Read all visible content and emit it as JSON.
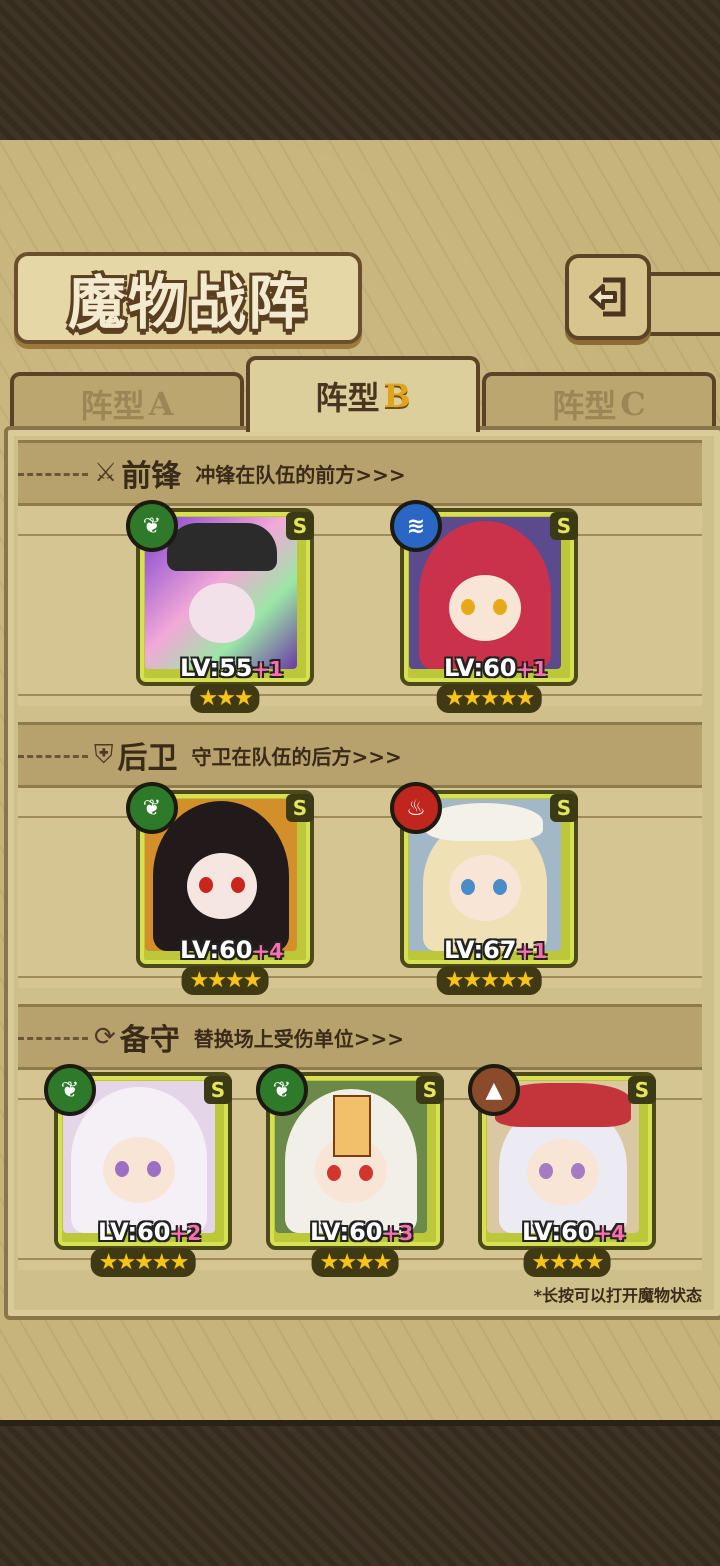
{
  "title": "魔物战阵",
  "back_icon": "back-arrow-icon",
  "tabs": [
    {
      "prefix": "阵型",
      "letter": "A",
      "active": false
    },
    {
      "prefix": "阵型",
      "letter": "B",
      "active": true
    },
    {
      "prefix": "阵型",
      "letter": "C",
      "active": false
    }
  ],
  "sections": {
    "front": {
      "icon": "sword-icon",
      "name": "前锋",
      "desc": "冲锋在队伍的前方>>>"
    },
    "back": {
      "icon": "shield-icon",
      "name": "后卫",
      "desc": "守卫在队伍的后方>>>"
    },
    "reserve": {
      "icon": "swap-icon",
      "name": "备守",
      "desc": "替换场上受伤单位>>>"
    }
  },
  "colors": {
    "nature": "#2f7a2a",
    "water": "#2a66c4",
    "fire": "#c0251e",
    "earth": "#8a4b2a",
    "star": "#f9c418"
  },
  "cards": {
    "front": [
      {
        "element": "nature",
        "rank": "S",
        "lv": "LV:55",
        "plus": "+1",
        "stars": "★★★"
      },
      {
        "element": "water",
        "rank": "S",
        "lv": "LV:60",
        "plus": "+1",
        "stars": "★★★★★"
      }
    ],
    "back": [
      {
        "element": "nature",
        "rank": "S",
        "lv": "LV:60",
        "plus": "+4",
        "stars": "★★★★"
      },
      {
        "element": "fire",
        "rank": "S",
        "lv": "LV:67",
        "plus": "+1",
        "stars": "★★★★★"
      }
    ],
    "reserve": [
      {
        "element": "nature",
        "rank": "S",
        "lv": "LV:60",
        "plus": "+2",
        "stars": "★★★★★"
      },
      {
        "element": "nature",
        "rank": "S",
        "lv": "LV:60",
        "plus": "+3",
        "stars": "★★★★"
      },
      {
        "element": "earth",
        "rank": "S",
        "lv": "LV:60",
        "plus": "+4",
        "stars": "★★★★"
      }
    ]
  },
  "hint": "*长按可以打开魔物状态"
}
